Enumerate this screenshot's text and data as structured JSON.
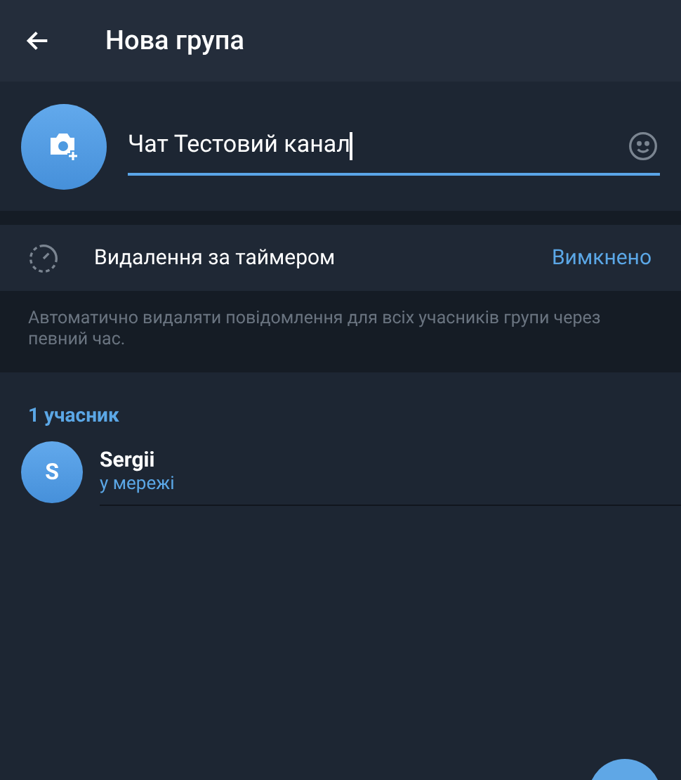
{
  "header": {
    "title": "Нова група"
  },
  "group_name": {
    "value": "Чат Тестовий канал"
  },
  "timer": {
    "label": "Видалення за таймером",
    "value": "Вимкнено"
  },
  "timer_hint": "Автоматично видаляти повідомлення для всіх учасників групи через певний час.",
  "members": {
    "heading": "1 учасник",
    "items": [
      {
        "initial": "S",
        "name": "Sergii",
        "status": "у мережі"
      }
    ]
  }
}
